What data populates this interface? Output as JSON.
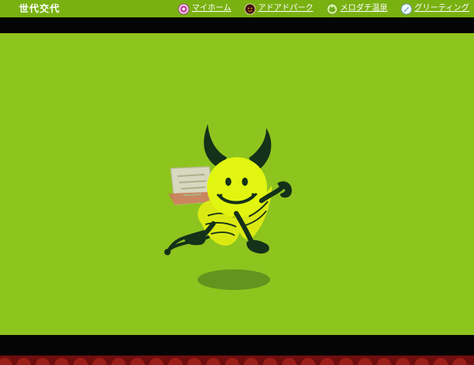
{
  "header": {
    "title": "世代交代",
    "nav": [
      {
        "label": "マイホーム",
        "icon": "home-face-icon"
      },
      {
        "label": "アドアドパーク",
        "icon": "park-face-icon"
      },
      {
        "label": "メロダチ温泉",
        "icon": "onsen-frog-icon"
      },
      {
        "label": "グリーティング",
        "icon": "greeting-card-icon"
      }
    ]
  },
  "colors": {
    "background": "#8dc31d",
    "header": "#79b111",
    "black_bar": "#050505",
    "mascot_body": "#e0f20e",
    "mascot_dark": "#14311a",
    "shadow": "#5d8b1e"
  }
}
